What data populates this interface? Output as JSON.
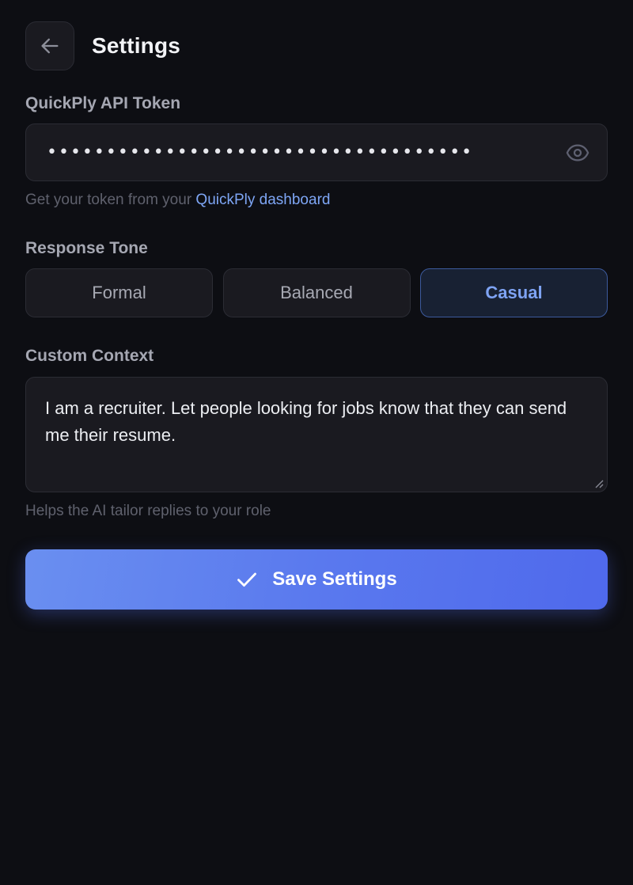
{
  "header": {
    "title": "Settings",
    "back_icon": "arrow-left-icon"
  },
  "api_token": {
    "label": "QuickPly API Token",
    "masked_value": "••••••••••••••••••••••••••••••••••••",
    "toggle_icon": "eye-icon",
    "hint_prefix": "Get your token from your ",
    "hint_link": "QuickPly dashboard"
  },
  "response_tone": {
    "label": "Response Tone",
    "options": [
      "Formal",
      "Balanced",
      "Casual"
    ],
    "selected": "Casual"
  },
  "custom_context": {
    "label": "Custom Context",
    "value": "I am a recruiter. Let people looking for jobs know that they can send me their resume.",
    "hint": "Helps the AI tailor replies to your role"
  },
  "save": {
    "label": "Save Settings",
    "icon": "check-icon"
  },
  "colors": {
    "background": "#0d0e13",
    "accent": "#7ea3f3",
    "button_gradient_start": "#6a8ff0",
    "button_gradient_end": "#4f69ec"
  }
}
